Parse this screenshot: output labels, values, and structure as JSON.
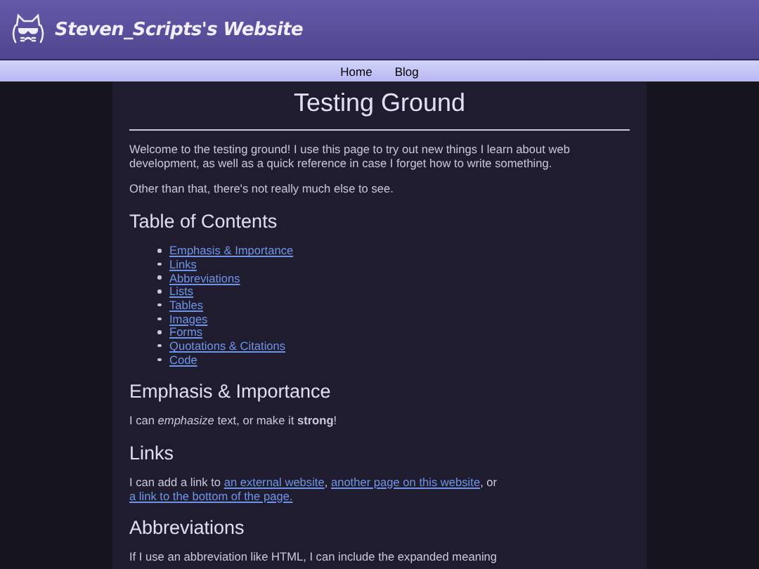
{
  "site_title": "Steven_Scripts's Website",
  "nav": [
    {
      "label": "Home"
    },
    {
      "label": "Blog"
    }
  ],
  "page_title": "Testing Ground",
  "intro": [
    "Welcome to the testing ground! I use this page to try out new things I learn about web development, as well as a quick reference in case I forget how to write something.",
    "Other than that, there's not really much else to see."
  ],
  "toc": {
    "heading": "Table of Contents",
    "items": [
      "Emphasis & Importance",
      "Links",
      "Abbreviations",
      "Lists",
      "Tables",
      "Images",
      "Forms",
      "Quotations & Citations",
      "Code"
    ]
  },
  "sections": [
    {
      "heading": "Emphasis & Importance",
      "body": [
        {
          "kind": "rich",
          "text": "I can *emphasize* text, or make it **strong**!"
        }
      ]
    },
    {
      "heading": "Links",
      "body": [
        {
          "kind": "text",
          "text": "I can add a link to "
        },
        {
          "kind": "link",
          "text": "an external website"
        },
        {
          "kind": "text",
          "text": ", "
        },
        {
          "kind": "link",
          "text": "another page on this website"
        },
        {
          "kind": "text",
          "text": ", or "
        },
        {
          "kind": "link",
          "text": "a link to the bottom of the page."
        }
      ]
    },
    {
      "heading": "Abbreviations",
      "body": [
        {
          "kind": "text",
          "text": "If I use an abbreviation like HTML, I can include the expanded meaning"
        }
      ]
    }
  ]
}
